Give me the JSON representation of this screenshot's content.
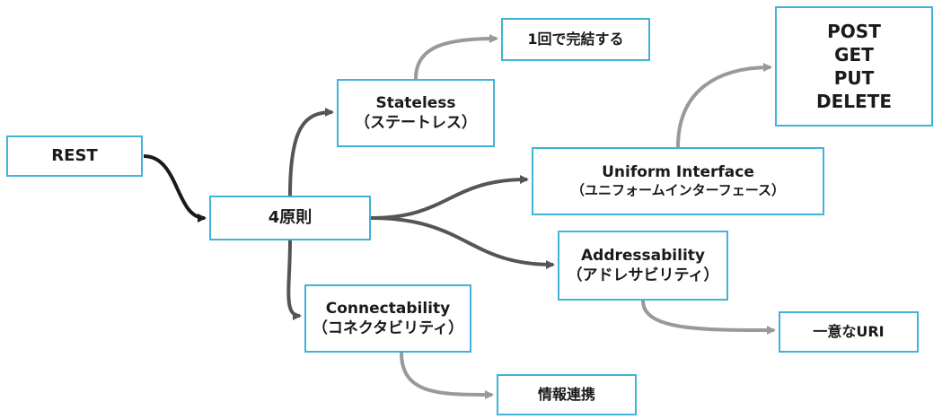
{
  "diagram": {
    "root": "REST",
    "principles": "4原則",
    "stateless": {
      "name": "Stateless",
      "reading": "（ステートレス）"
    },
    "stateless_child": "1回で完結する",
    "uniform": {
      "name": "Uniform Interface",
      "reading": "（ユニフォームインターフェース）"
    },
    "methods": [
      "POST",
      "GET",
      "PUT",
      "DELETE"
    ],
    "addressability": {
      "name": "Addressability",
      "reading": "（アドレサビリティ）"
    },
    "address_child": "一意なURI",
    "connectability": {
      "name": "Connectability",
      "reading": "（コネクタビリティ）"
    },
    "connect_child": "情報連携"
  },
  "colors": {
    "box_border": "#3fb3d8",
    "text": "#1a1a1a",
    "connector_dark": "#1a1a1a",
    "connector_mid": "#555555",
    "connector_light": "#999999"
  }
}
